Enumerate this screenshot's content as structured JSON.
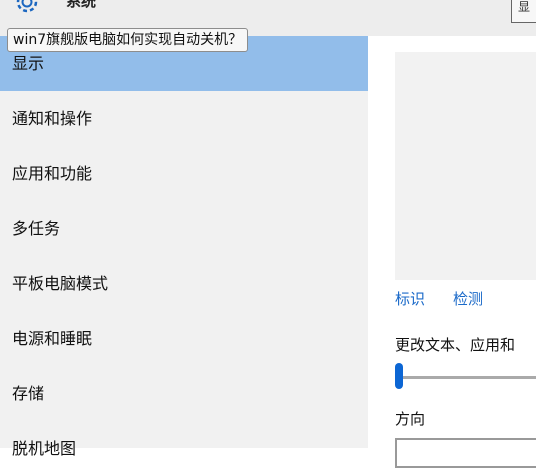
{
  "window": {
    "title": "系统",
    "top_right_glyph": "显"
  },
  "tooltip": {
    "text": "win7旗舰版电脑如何实现自动关机？"
  },
  "sidebar": {
    "items": [
      {
        "label": "显示",
        "active": true
      },
      {
        "label": "通知和操作",
        "active": false
      },
      {
        "label": "应用和功能",
        "active": false
      },
      {
        "label": "多任务",
        "active": false
      },
      {
        "label": "平板电脑模式",
        "active": false
      },
      {
        "label": "电源和睡眠",
        "active": false
      },
      {
        "label": "存储",
        "active": false
      },
      {
        "label": "脱机地图",
        "active": false
      }
    ]
  },
  "content": {
    "identify_link": "标识",
    "detect_link": "检测",
    "scale_label": "更改文本、应用和",
    "scale_slider_value": 0,
    "orientation_label": "方向"
  },
  "colors": {
    "accent": "#1c67c0",
    "active_nav": "#92bdea",
    "sidebar_bg": "#f1f1f1",
    "link": "#1b6ac9",
    "slider_thumb": "#0c66d4"
  }
}
